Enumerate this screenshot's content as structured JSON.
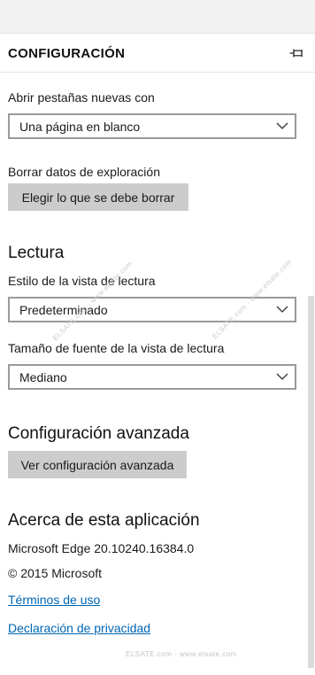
{
  "panel": {
    "title": "CONFIGURACIÓN"
  },
  "general": {
    "new_tabs_label": "Abrir pestañas nuevas con",
    "new_tabs_value": "Una página en blanco",
    "clear_data_label": "Borrar datos de exploración",
    "clear_data_button": "Elegir lo que se debe borrar"
  },
  "reading": {
    "heading": "Lectura",
    "style_label": "Estilo de la vista de lectura",
    "style_value": "Predeterminado",
    "font_size_label": "Tamaño de fuente de la vista de lectura",
    "font_size_value": "Mediano"
  },
  "advanced": {
    "heading": "Configuración avanzada",
    "button": "Ver configuración avanzada"
  },
  "about": {
    "heading": "Acerca de esta aplicación",
    "version": "Microsoft Edge 20.10240.16384.0",
    "copyright": "© 2015 Microsoft",
    "terms_link": "Términos de uso",
    "privacy_link": "Declaración de privacidad"
  },
  "watermarks": {
    "diagonal_1": "ELSATE.com - www.elsate.com",
    "diagonal_2": "ELSATE.com - www.elsate.com",
    "bottom": "ELSATE.com - www.elsate.com"
  },
  "icons": {
    "pin": "pin-icon",
    "chevron": "chevron-down-icon"
  },
  "colors": {
    "link": "#0066b4",
    "button": "#cccccc",
    "select_border": "#9a9a9a"
  }
}
